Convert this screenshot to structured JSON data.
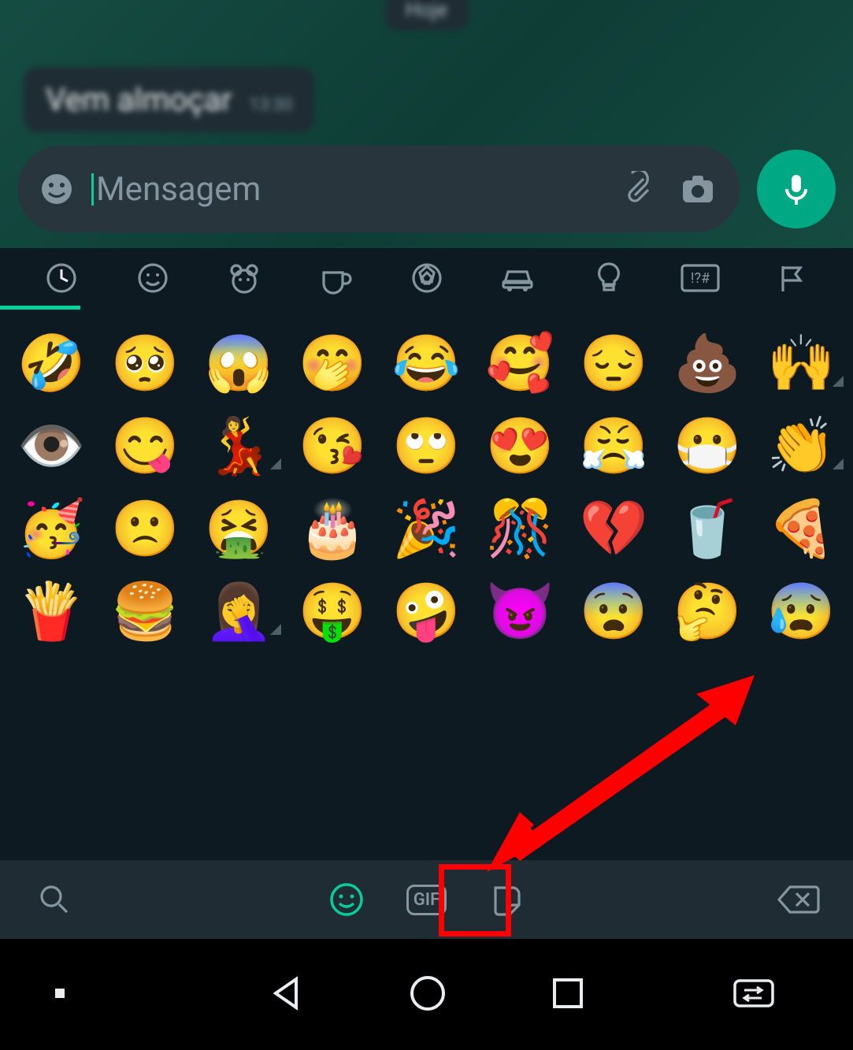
{
  "chat": {
    "date_badge": "Hoje",
    "incoming_message": {
      "text": "Vem almoçar",
      "time": "13:30"
    }
  },
  "composer": {
    "placeholder": "Mensagem",
    "icons": {
      "emoji": "emoji-icon",
      "attach": "paperclip-icon",
      "camera": "camera-icon",
      "mic": "mic-icon"
    }
  },
  "emoji_panel": {
    "categories": [
      {
        "id": "recent",
        "icon": "clock-icon",
        "active": true
      },
      {
        "id": "smileys",
        "icon": "smiley-icon",
        "active": false
      },
      {
        "id": "animals",
        "icon": "bear-icon",
        "active": false
      },
      {
        "id": "food",
        "icon": "cup-icon",
        "active": false
      },
      {
        "id": "activity",
        "icon": "soccer-icon",
        "active": false
      },
      {
        "id": "travel",
        "icon": "car-icon",
        "active": false
      },
      {
        "id": "objects",
        "icon": "lightbulb-icon",
        "active": false
      },
      {
        "id": "symbols",
        "icon": "symbols-icon",
        "active": false
      },
      {
        "id": "flags",
        "icon": "flag-icon",
        "active": false
      }
    ],
    "recent_emojis": [
      {
        "char": "🤣",
        "skin_tone": false
      },
      {
        "char": "🥺",
        "skin_tone": false
      },
      {
        "char": "😱",
        "skin_tone": false
      },
      {
        "char": "🤭",
        "skin_tone": false
      },
      {
        "char": "😂",
        "skin_tone": false
      },
      {
        "char": "🥰",
        "skin_tone": false
      },
      {
        "char": "😔",
        "skin_tone": false
      },
      {
        "char": "💩",
        "skin_tone": false
      },
      {
        "char": "🙌",
        "skin_tone": true
      },
      {
        "char": "👁️",
        "skin_tone": false
      },
      {
        "char": "😋",
        "skin_tone": false
      },
      {
        "char": "💃",
        "skin_tone": true
      },
      {
        "char": "😘",
        "skin_tone": false
      },
      {
        "char": "🙄",
        "skin_tone": false
      },
      {
        "char": "😍",
        "skin_tone": false
      },
      {
        "char": "😤",
        "skin_tone": false
      },
      {
        "char": "😷",
        "skin_tone": false
      },
      {
        "char": "👏",
        "skin_tone": true
      },
      {
        "char": "🥳",
        "skin_tone": false
      },
      {
        "char": "🙁",
        "skin_tone": false
      },
      {
        "char": "🤮",
        "skin_tone": false
      },
      {
        "char": "🎂",
        "skin_tone": false
      },
      {
        "char": "🎉",
        "skin_tone": false
      },
      {
        "char": "🎊",
        "skin_tone": false
      },
      {
        "char": "💔",
        "skin_tone": false
      },
      {
        "char": "🥤",
        "skin_tone": false
      },
      {
        "char": "🍕",
        "skin_tone": false
      },
      {
        "char": "🍟",
        "skin_tone": false
      },
      {
        "char": "🍔",
        "skin_tone": false
      },
      {
        "char": "🤦‍♀️",
        "skin_tone": true
      },
      {
        "char": "🤑",
        "skin_tone": false
      },
      {
        "char": "🤪",
        "skin_tone": false
      },
      {
        "char": "😈",
        "skin_tone": false
      },
      {
        "char": "😨",
        "skin_tone": false
      },
      {
        "char": "🤔",
        "skin_tone": false
      },
      {
        "char": "😰",
        "skin_tone": false
      }
    ]
  },
  "picker_bar": {
    "search": "search-icon",
    "tabs": [
      {
        "id": "emoji",
        "icon": "smiley-icon",
        "active": true
      },
      {
        "id": "gif",
        "label": "GIF",
        "icon": "gif-icon",
        "active": false
      },
      {
        "id": "sticker",
        "icon": "sticker-icon",
        "active": false
      }
    ],
    "backspace": "backspace-icon"
  },
  "annotation": {
    "highlight_target": "sticker-tab",
    "arrow_color": "#ff0000",
    "box_color": "#ff0000"
  },
  "android_nav": {
    "buttons": [
      "minimize",
      "back",
      "home",
      "recent",
      "switch"
    ]
  }
}
